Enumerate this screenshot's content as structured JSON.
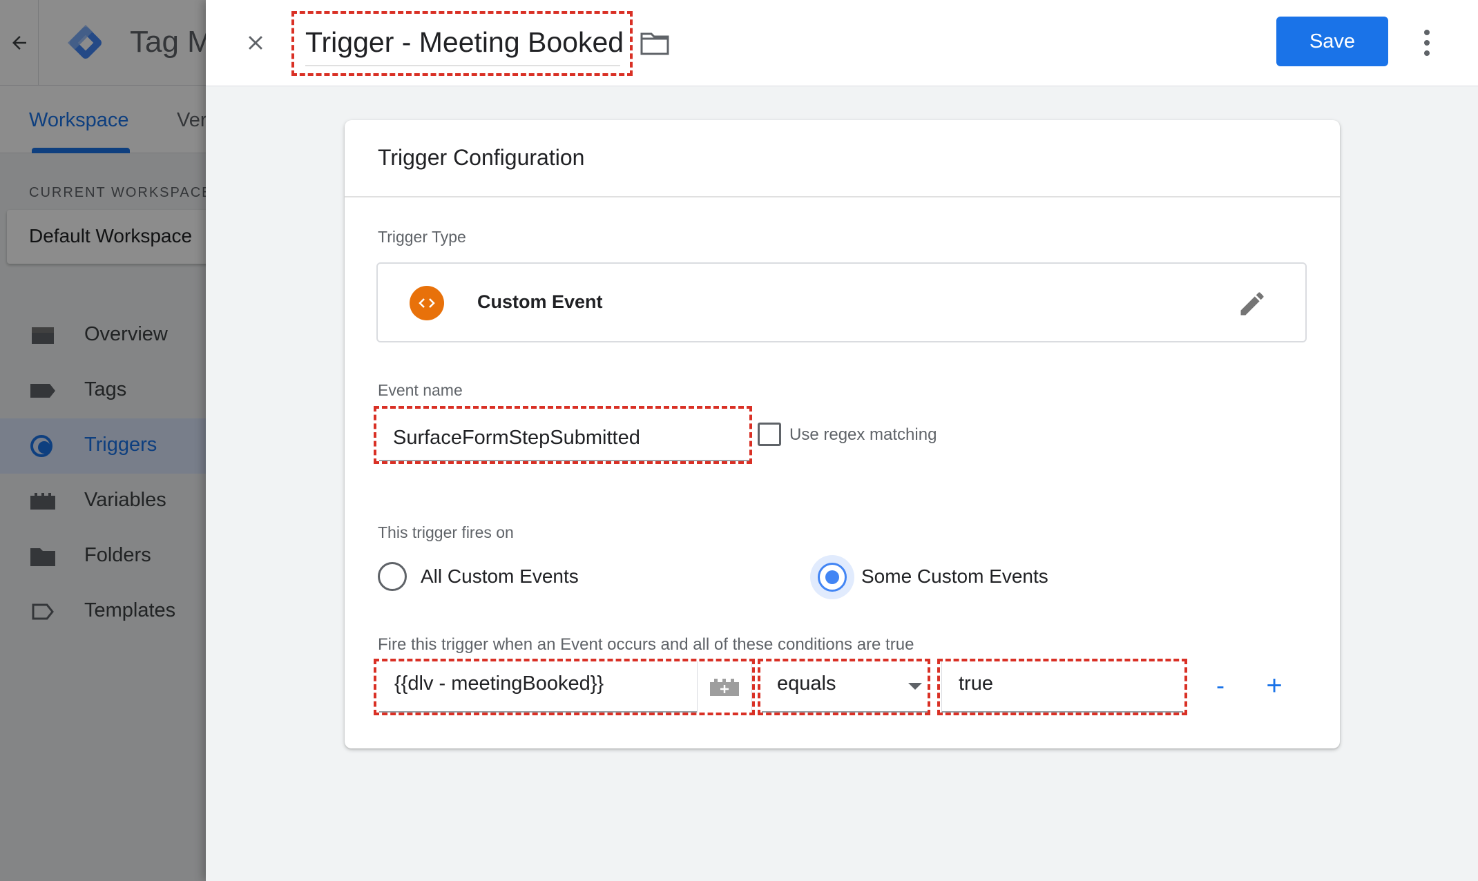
{
  "app": {
    "title": "Tag Manager",
    "tabs": [
      "Workspace",
      "Versions"
    ],
    "current_workspace_label": "CURRENT WORKSPACE",
    "workspace_name": "Default Workspace",
    "nav": [
      {
        "label": "Overview",
        "icon": "overview-icon"
      },
      {
        "label": "Tags",
        "icon": "tag-icon"
      },
      {
        "label": "Triggers",
        "icon": "trigger-icon",
        "active": true
      },
      {
        "label": "Variables",
        "icon": "variable-icon"
      },
      {
        "label": "Folders",
        "icon": "folder-icon"
      },
      {
        "label": "Templates",
        "icon": "template-icon"
      }
    ]
  },
  "panel": {
    "title": "Trigger - Meeting Booked",
    "save_label": "Save"
  },
  "card": {
    "title": "Trigger Configuration",
    "trigger_type_label": "Trigger Type",
    "trigger_type": "Custom Event",
    "event_name_label": "Event name",
    "event_name": "SurfaceFormStepSubmitted",
    "regex_label": "Use regex matching",
    "regex_checked": false,
    "fires_on_label": "This trigger fires on",
    "fires_on_options": [
      "All Custom Events",
      "Some Custom Events"
    ],
    "fires_on_selected": "Some Custom Events",
    "conditions_label": "Fire this trigger when an Event occurs and all of these conditions are true",
    "condition": {
      "variable": "{{dlv - meetingBooked}}",
      "operator": "equals",
      "value": "true"
    },
    "remove_label": "-",
    "add_label": "+"
  },
  "colors": {
    "accent": "#1a73e8",
    "radio_selected": "#4285f4",
    "custom_event_icon": "#e8710a",
    "highlight_dash": "#d93025"
  }
}
